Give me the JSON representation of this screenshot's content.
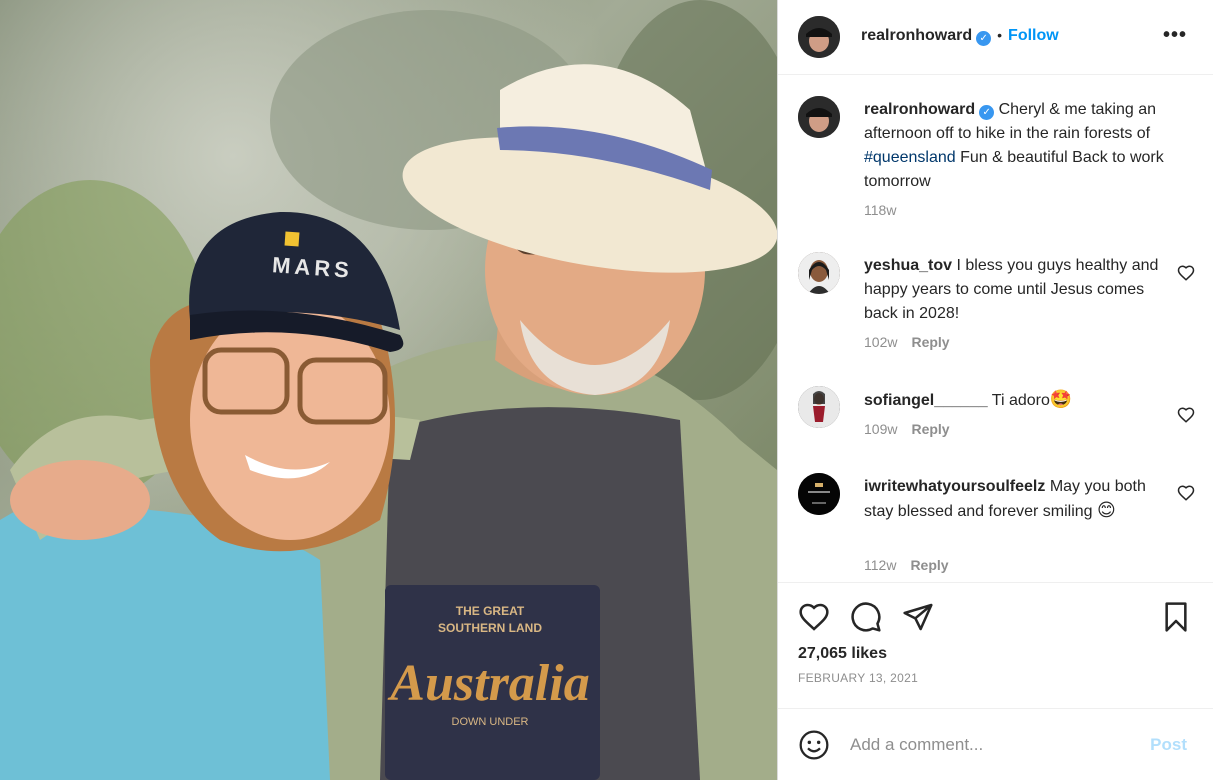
{
  "post": {
    "author": "realronhoward",
    "follow_label": "Follow",
    "separator": "•",
    "more_label": "•••"
  },
  "caption": {
    "username": "realronhoward",
    "text_before": "Cheryl & me taking an afternoon off to hike in the rain forests of ",
    "hashtag": "#queensland",
    "text_after": " Fun & beautiful Back to work tomorrow",
    "time": "118w"
  },
  "comments": [
    {
      "username": "yeshua_tov",
      "text": "I bless you guys healthy and happy years to come until Jesus comes back in 2028!",
      "time": "102w",
      "reply": "Reply"
    },
    {
      "username": "sofiangel______",
      "text": "Ti adoro",
      "emoji": "🤩",
      "time": "109w",
      "reply": "Reply"
    },
    {
      "username": "iwritewhatyoursoulfeelz",
      "text": "May you both stay blessed and forever smiling",
      "emoji": "😊",
      "time": "112w",
      "reply": "Reply"
    }
  ],
  "photo": {
    "cap_text": "MARS",
    "shirt_line1": "THE GREAT",
    "shirt_line2": "SOUTHERN LAND",
    "shirt_word": "Australia",
    "shirt_line3": "DOWN UNDER"
  },
  "stats": {
    "likes": "27,065 likes",
    "date": "FEBRUARY 13, 2021"
  },
  "composer": {
    "placeholder": "Add a comment...",
    "post_label": "Post"
  },
  "colors": {
    "accent": "#0095f6",
    "verified": "#3897f0",
    "post_disabled": "#b2dffc",
    "secondary_text": "#8e8e8e"
  }
}
